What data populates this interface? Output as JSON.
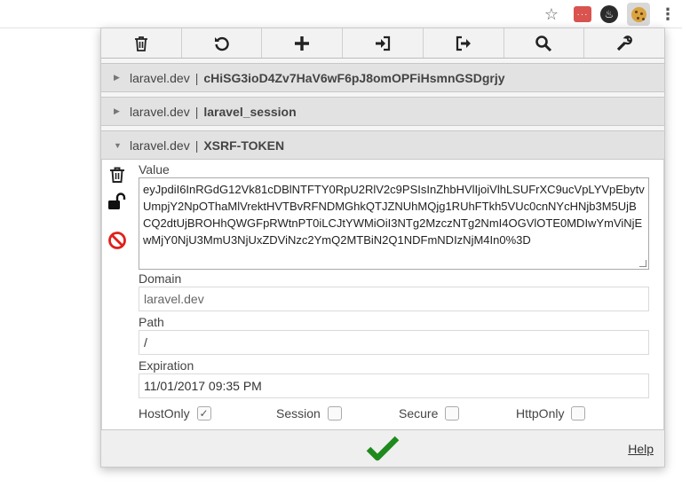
{
  "browser": {
    "star_icon": "star-outline-icon",
    "extensions": [
      {
        "name": "ext-red-icon",
        "glyph": "···"
      },
      {
        "name": "flame-icon",
        "glyph": "♨"
      },
      {
        "name": "cookie-icon",
        "glyph": ""
      }
    ],
    "menu_glyph": "⋮"
  },
  "toolbar": {
    "buttons": [
      {
        "name": "delete-all-button",
        "icon": "trash-icon"
      },
      {
        "name": "refresh-button",
        "icon": "refresh-icon"
      },
      {
        "name": "add-cookie-button",
        "icon": "plus-icon"
      },
      {
        "name": "import-button",
        "icon": "import-icon"
      },
      {
        "name": "export-button",
        "icon": "export-icon"
      },
      {
        "name": "search-button",
        "icon": "search-icon"
      },
      {
        "name": "settings-button",
        "icon": "wrench-icon"
      }
    ]
  },
  "cookies": [
    {
      "arrow": "▶",
      "domain": "laravel.dev",
      "separator": "|",
      "name": "cHiSG3ioD4Zv7HaV6wF6pJ8omOPFiHsmnGSDgrjy"
    },
    {
      "arrow": "▶",
      "domain": "laravel.dev",
      "separator": "|",
      "name": "laravel_session"
    },
    {
      "arrow": "▼",
      "domain": "laravel.dev",
      "separator": "|",
      "name": "XSRF-TOKEN"
    }
  ],
  "details": {
    "value_label": "Value",
    "value": "eyJpdiI6InRGdG12Vk81cDBlNTFTY0RpU2RlV2c9PSIsInZhbHVlIjoiVlhLSUFrXC9ucVpLYVpEbytvUmpjY2NpOThaMlVrektHVTBvRFNDMGhkQTJZNUhMQjg1RUhFTkh5VUc0cnNYcHNjb3M5UjBCQ2dtUjBROHhQWGFpRWtnPT0iLCJtYWMiOiI3NTg2MzczNTg2NmI4OGVlOTE0MDIwYmViNjEwMjY0NjU3MmU3NjUxZDViNzc2YmQ2MTBiN2Q1NDFmNDIzNjM4In0%3D",
    "domain_label": "Domain",
    "domain": "laravel.dev",
    "path_label": "Path",
    "path": "/",
    "expiration_label": "Expiration",
    "expiration": "11/01/2017 09:35 PM",
    "flags": [
      {
        "label": "HostOnly",
        "checked": true
      },
      {
        "label": "Session",
        "checked": false
      },
      {
        "label": "Secure",
        "checked": false
      },
      {
        "label": "HttpOnly",
        "checked": false
      }
    ],
    "side_icons": [
      "trash-icon",
      "unlock-icon",
      "block-icon"
    ]
  },
  "footer": {
    "submit_icon": "checkmark-icon",
    "help_label": "Help"
  },
  "colors": {
    "checkmark": "#1e8a1e",
    "block": "#e0201c"
  }
}
